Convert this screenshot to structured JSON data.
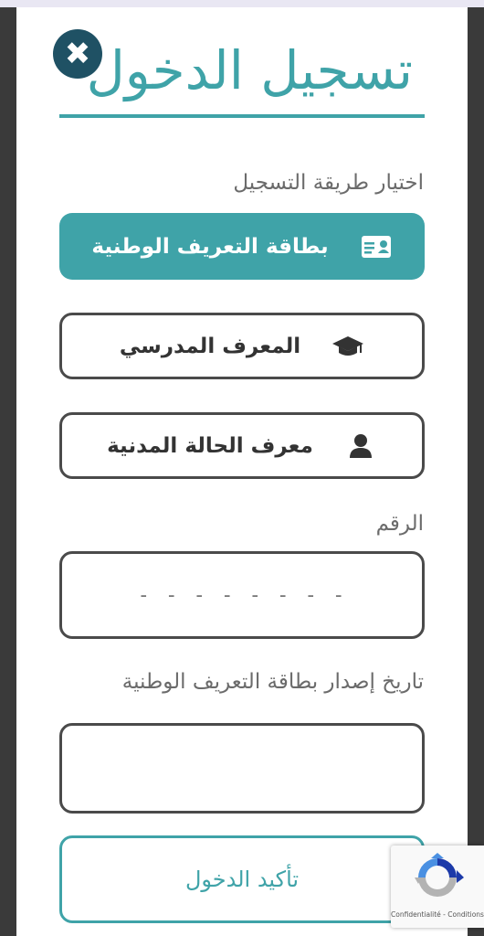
{
  "header": {
    "title": "تسجيل الدخول",
    "close_glyph": "✖"
  },
  "login_method": {
    "label": "اختيار طريقة التسجيل",
    "options": [
      {
        "label": "بطاقة التعريف الوطنية",
        "icon": "id-card-icon",
        "selected": true
      },
      {
        "label": "المعرف المدرسي",
        "icon": "graduation-cap-icon",
        "selected": false
      },
      {
        "label": "معرف الحالة المدنية",
        "icon": "user-icon",
        "selected": false
      }
    ]
  },
  "number_field": {
    "label": "الرقم",
    "placeholder": "- - - - - - - -",
    "value": ""
  },
  "issue_date_field": {
    "label": "تاريخ إصدار بطاقة التعريف الوطنية",
    "value": ""
  },
  "submit": {
    "label": "تأكيد الدخول"
  },
  "recaptcha": {
    "links": "Confidentialité - Conditions"
  },
  "colors": {
    "accent": "#3fa3a8",
    "close_button": "#1f5164",
    "border": "#4a4a4a",
    "label_text": "#6b6b6b",
    "side_background": "#3a3a3a"
  }
}
